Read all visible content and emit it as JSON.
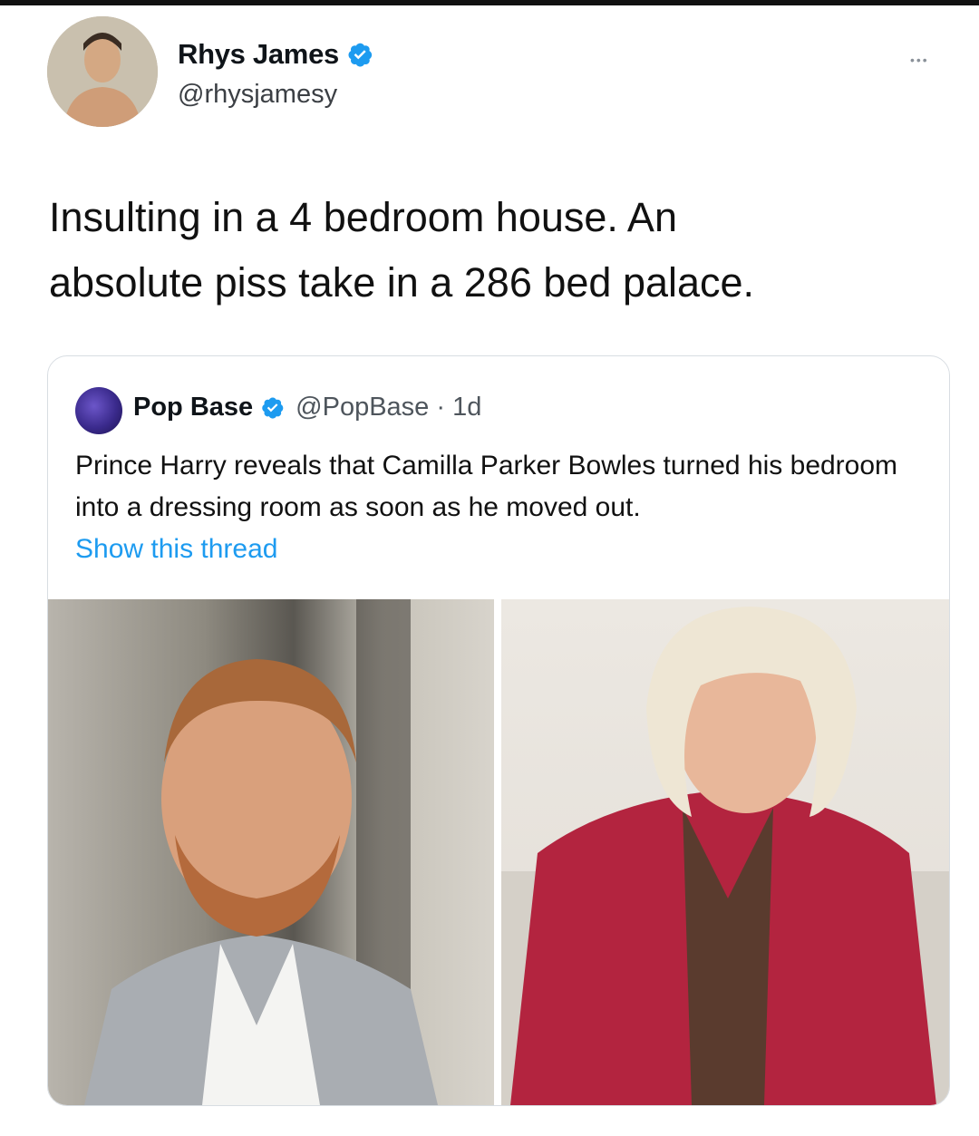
{
  "author": {
    "name": "Rhys James",
    "handle": "@rhysjamesy",
    "avatar_icon": "profile-photo",
    "verified": true
  },
  "more_label": "•••",
  "tweet_text": "Insulting in a 4 bedroom house. An\nabsolute piss take in a 286 bed palace.",
  "quoted": {
    "name": "Pop Base",
    "meta": "@PopBase · 1d",
    "verified": true,
    "text": "Prince Harry reveals that Camilla Parker Bowles turned his bedroom into a dressing room as soon as he moved out.",
    "show_thread": "Show this thread",
    "images": [
      "photo-man-grey-jacket",
      "photo-woman-red-jacket"
    ]
  },
  "colors": {
    "link": "#1d9bf0",
    "verified": "#1d9bf0",
    "card_border": "#d8dde2"
  }
}
